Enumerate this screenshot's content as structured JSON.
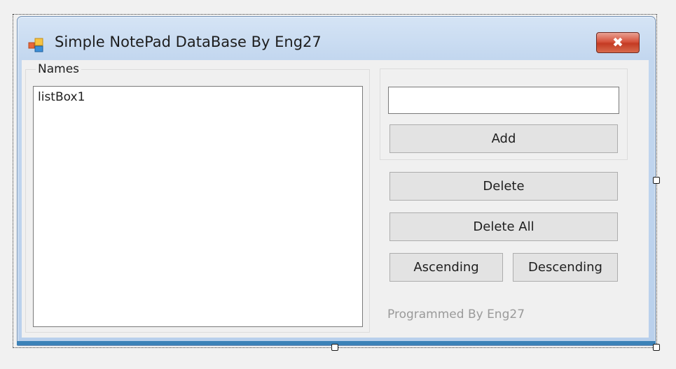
{
  "window": {
    "title": "Simple NotePad DataBase By Eng27",
    "icon": "windows-form-icon",
    "close_label": "✖"
  },
  "names_group": {
    "label": "Names",
    "listbox_text": "listBox1"
  },
  "add_group": {
    "input_value": "",
    "add_label": "Add"
  },
  "buttons": {
    "delete_label": "Delete",
    "delete_all_label": "Delete All",
    "ascending_label": "Ascending",
    "descending_label": "Descending"
  },
  "footer": {
    "credit": "Programmed By Eng27"
  },
  "colors": {
    "close_button": "#d04a33",
    "selection_border": "#3b82b8",
    "credit_text": "#9a9a9a"
  }
}
